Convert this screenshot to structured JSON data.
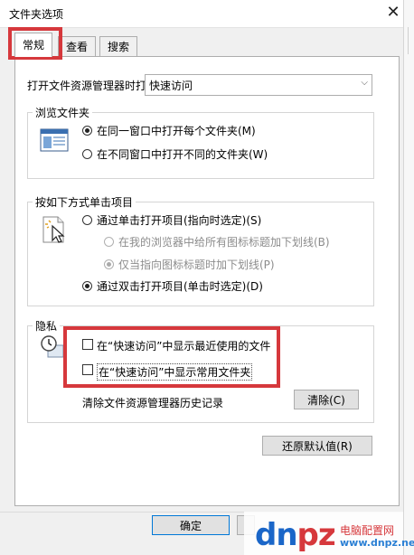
{
  "window": {
    "title": "文件夹选项",
    "close_icon": "close-icon"
  },
  "tabs": [
    {
      "label": "常规",
      "active": true
    },
    {
      "label": "查看",
      "active": false
    },
    {
      "label": "搜索",
      "active": false
    }
  ],
  "open_explorer": {
    "label": "打开文件资源管理器时打",
    "value": "快速访问"
  },
  "browse_folders": {
    "legend": "浏览文件夹",
    "icon": "folder-window-icon",
    "options": [
      {
        "label": "在同一窗口中打开每个文件夹(M)",
        "checked": true
      },
      {
        "label": "在不同窗口中打开不同的文件夹(W)",
        "checked": false
      }
    ]
  },
  "click_items": {
    "legend": "按如下方式单击项目",
    "icon": "cursor-click-icon",
    "single_click": {
      "label": "通过单击打开项目(指向时选定)(S)",
      "checked": false
    },
    "underline_all": {
      "label": "在我的浏览器中给所有图标标题加下划线(B)",
      "checked": false,
      "enabled": false
    },
    "underline_hover": {
      "label": "仅当指向图标标题时加下划线(P)",
      "checked": true,
      "enabled": false
    },
    "double_click": {
      "label": "通过双击打开项目(单击时选定)(D)",
      "checked": true
    }
  },
  "privacy": {
    "legend": "隐私",
    "icon": "clock-icon",
    "show_recent_files": {
      "label": "在“快速访问”中显示最近使用的文件",
      "checked": false
    },
    "show_frequent_folders": {
      "label": "在“快速访问”中显示常用文件夹",
      "checked": false
    },
    "clear_history_label": "清除文件资源管理器历史记录",
    "clear_button": "清除(C)"
  },
  "restore_defaults_button": "还原默认值(R)",
  "ok_button": "确定",
  "watermark": {
    "logo": "dnpz.net",
    "text": "电脑配置网",
    "url": "www.dnpz.net"
  },
  "colors": {
    "highlight_red": "#d6383c",
    "window_bg": "#f0f0f0",
    "panel_bg": "#ffffff"
  }
}
